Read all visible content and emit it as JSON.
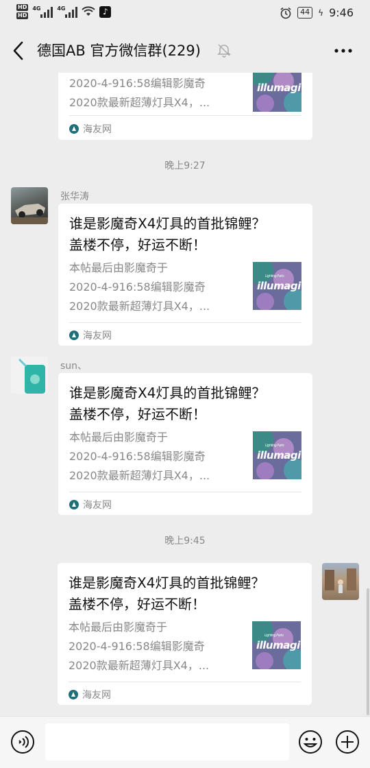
{
  "status_bar": {
    "sim_labels": [
      "HD",
      "HD"
    ],
    "network_1": "4G",
    "network_2": "4G",
    "battery": "44",
    "time": "9:46"
  },
  "nav": {
    "title": "德国AB  官方微信群(229)",
    "icons": [
      "back-arrow",
      "muted-bell",
      "more-dots"
    ]
  },
  "link_card": {
    "title_line1": "谁是影魔奇X4灯具的首批锦鲤？",
    "title_line2": "盖楼不停，好运不断！",
    "desc_line1": "本帖最后由影魔奇于",
    "desc_line2": "2020-4-916:58编辑影魔奇",
    "desc_line3": "2020款最新超薄灯具X4，...",
    "source": "海友网",
    "thumb_brand": "illumagi",
    "thumb_tagline": "Lighting Parts"
  },
  "timestamps": [
    "晚上9:27",
    "晚上9:45"
  ],
  "messages": [
    {
      "sender": "张华涛",
      "avatar": "race-car-avatar"
    },
    {
      "sender": "sun、",
      "avatar": "bag-avatar"
    },
    {
      "sender": "",
      "avatar": "street-photo-avatar",
      "self": true
    }
  ],
  "input_bar": {
    "placeholder": "",
    "icons": [
      "voice-icon",
      "emoji-icon",
      "plus-icon"
    ]
  },
  "colors": {
    "background": "#ededed",
    "card": "#ffffff",
    "meta_text": "#888888"
  }
}
